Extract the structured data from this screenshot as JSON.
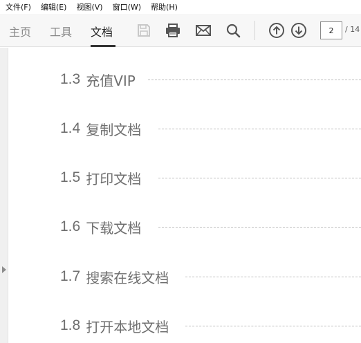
{
  "menubar": {
    "items": [
      "文件(F)",
      "编辑(E)",
      "视图(V)",
      "窗口(W)",
      "帮助(H)"
    ]
  },
  "toolbar": {
    "tabs": [
      "主页",
      "工具",
      "文档"
    ],
    "active_tab": "文档",
    "icons": [
      "save-icon",
      "print-icon",
      "mail-icon",
      "search-icon",
      "arrow-up-circle-icon",
      "arrow-down-circle-icon"
    ],
    "page_current": "2",
    "page_total": "/ 14"
  },
  "colors": {
    "toolbar_bg": "#f7f7f7",
    "icon_active": "#555555",
    "icon_disabled": "#c8c8c8",
    "toc_text": "#6e6e6e",
    "leader": "#bdbdbd"
  },
  "toc": [
    {
      "num": "1.3",
      "label": "充值VIP"
    },
    {
      "num": "1.4",
      "label": "复制文档"
    },
    {
      "num": "1.5",
      "label": "打印文档"
    },
    {
      "num": "1.6",
      "label": "下载文档"
    },
    {
      "num": "1.7",
      "label": "搜索在线文档"
    },
    {
      "num": "1.8",
      "label": "打开本地文档"
    }
  ]
}
